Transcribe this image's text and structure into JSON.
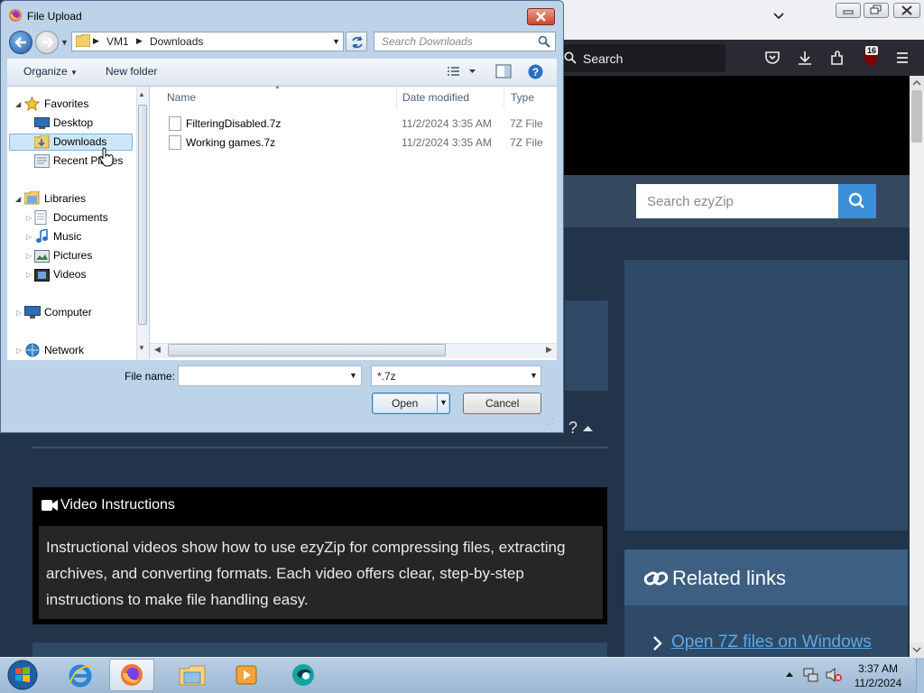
{
  "browser": {
    "search_placeholder": "Search",
    "downloads_badge": "16",
    "site_search_placeholder": "Search ezyZip",
    "help_marker": "?"
  },
  "video_section": {
    "title": "Video Instructions",
    "body": "Instructional videos show how to use ezyZip for compressing files, extracting archives, and converting formats. Each video offers clear, step-by-step instructions to make file handling easy."
  },
  "related": {
    "title": "Related links",
    "link": "Open 7Z files on Windows"
  },
  "dialog": {
    "title": "File Upload",
    "breadcrumb": [
      "VM1",
      "Downloads"
    ],
    "search_placeholder": "Search Downloads",
    "toolbar": {
      "organize": "Organize",
      "new_folder": "New folder"
    },
    "nav": {
      "favorites": "Favorites",
      "desktop": "Desktop",
      "downloads": "Downloads",
      "recent": "Recent Places",
      "libraries": "Libraries",
      "documents": "Documents",
      "music": "Music",
      "pictures": "Pictures",
      "videos": "Videos",
      "computer": "Computer",
      "network": "Network"
    },
    "columns": {
      "name": "Name",
      "date": "Date modified",
      "type": "Type"
    },
    "files": [
      {
        "name": "FilteringDisabled.7z",
        "date": "11/2/2024 3:35 AM",
        "type": "7Z File"
      },
      {
        "name": "Working games.7z",
        "date": "11/2/2024 3:35 AM",
        "type": "7Z File"
      }
    ],
    "filename_label": "File name:",
    "filename_value": "",
    "filetype": "*.7z",
    "open_label": "Open",
    "cancel_label": "Cancel"
  },
  "taskbar": {
    "time": "3:37 AM",
    "date": "11/2/2024"
  },
  "colors": {
    "page_bg": "#22344a",
    "panel": "#2f4a66",
    "link": "#5da9e9",
    "search_button": "#3a8fd8",
    "selection": "#cde6f7"
  },
  "icons": [
    "firefox-icon",
    "back-icon",
    "forward-icon",
    "refresh-icon",
    "search-icon",
    "views-icon",
    "preview-pane-icon",
    "help-icon",
    "star-icon",
    "folder-icon",
    "file-icon",
    "pocket-icon",
    "download-icon",
    "extensions-icon",
    "ublock-icon",
    "menu-icon",
    "video-icon",
    "link-icon",
    "chevron-right-icon",
    "windows-start-icon",
    "ie-icon",
    "explorer-icon",
    "media-player-icon",
    "network-tray-icon",
    "volume-muted-icon"
  ]
}
